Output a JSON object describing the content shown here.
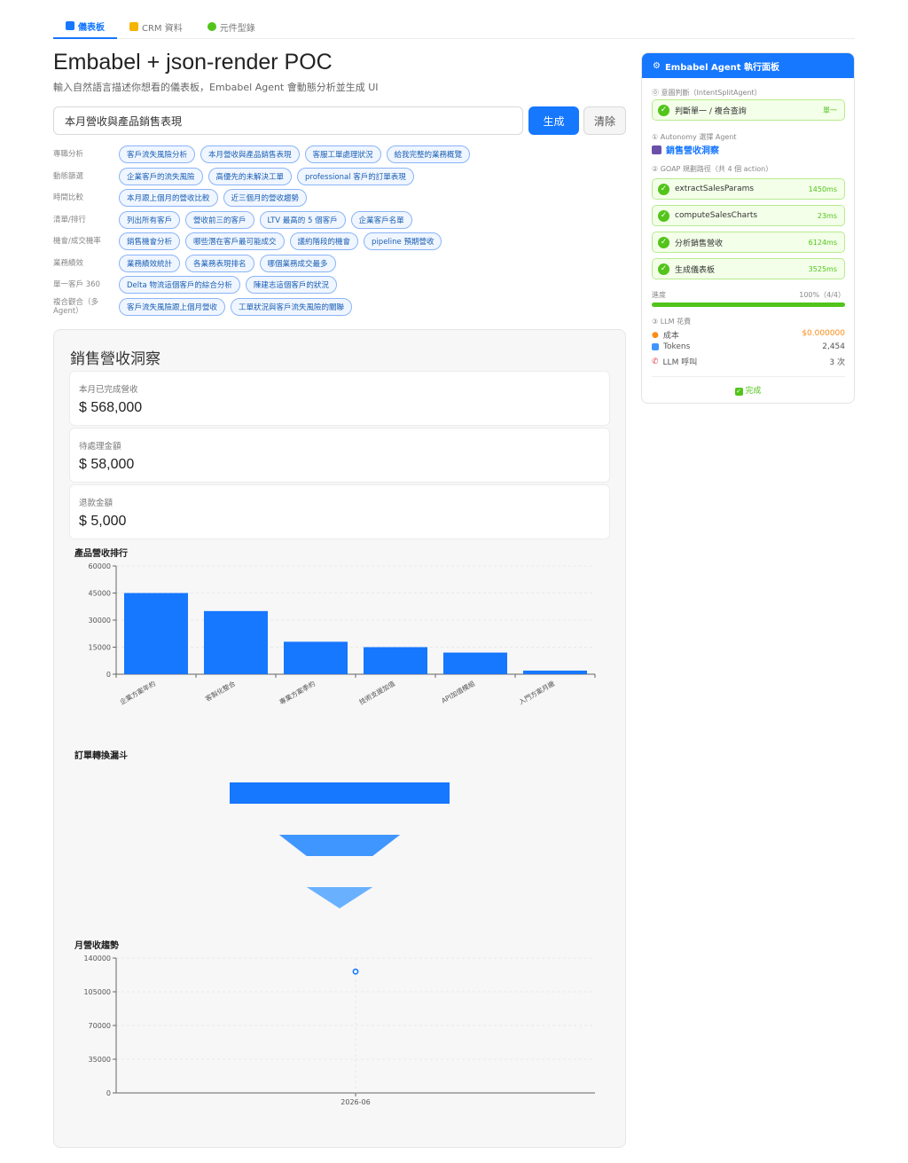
{
  "nav": {
    "tabs": [
      {
        "label": "儀表板",
        "icon": "bar-chart-icon",
        "color": "#1677ff"
      },
      {
        "label": "CRM 資料",
        "icon": "folder-icon",
        "color": "#f5b400"
      },
      {
        "label": "元件型錄",
        "icon": "puzzle-icon",
        "color": "#52c41a"
      }
    ]
  },
  "header": {
    "title": "Embabel + json-render POC",
    "subtitle": "輸入自然語言描述你想看的儀表板，Embabel Agent 會動態分析並生成 UI"
  },
  "query": {
    "value": "本月營收與產品銷售表現",
    "generate_label": "生成",
    "clear_label": "清除"
  },
  "suggestions": [
    {
      "category": "專職分析",
      "chips": [
        "客戶流失風險分析",
        "本月營收與產品銷售表現",
        "客服工單處理狀況",
        "給我完整的業務概覽"
      ]
    },
    {
      "category": "動態篩選",
      "chips": [
        "企業客戶的流失風險",
        "高優先的未解決工單",
        "professional 客戶的訂單表現"
      ]
    },
    {
      "category": "時間比較",
      "chips": [
        "本月跟上個月的營收比較",
        "近三個月的營收趨勢"
      ]
    },
    {
      "category": "清單/排行",
      "chips": [
        "列出所有客戶",
        "營收前三的客戶",
        "LTV 最高的 5 個客戶",
        "企業客戶名單"
      ]
    },
    {
      "category": "機會/成交機率",
      "chips": [
        "銷售機會分析",
        "哪些潛在客戶最可能成交",
        "議約階段的機會",
        "pipeline 預期營收"
      ]
    },
    {
      "category": "業務績效",
      "chips": [
        "業務績效統計",
        "各業務表現排名",
        "哪個業務成交最多"
      ]
    },
    {
      "category": "單一客戶 360",
      "chips": [
        "Delta 物流這個客戶的綜合分析",
        "陳建志這個客戶的狀況"
      ]
    },
    {
      "category": "複合觀合（多 Agent）",
      "chips": [
        "客戶流失風險跟上個月營收",
        "工單狀況與客戶流失風險的關聯"
      ]
    }
  ],
  "insight": {
    "title": "銷售營收洞察",
    "metrics": [
      {
        "label": "本月已完成營收",
        "value": "$ 568,000"
      },
      {
        "label": "待處理金額",
        "value": "$ 58,000"
      },
      {
        "label": "退款金額",
        "value": "$ 5,000"
      }
    ],
    "bar_title": "產品營收排行",
    "funnel_title": "訂單轉換漏斗",
    "line_title": "月營收趨勢"
  },
  "chart_data": [
    {
      "type": "bar",
      "title": "產品營收排行",
      "categories": [
        "企業方案年約",
        "客製化整合",
        "專業方案季約",
        "技術支援加值",
        "API加值模組",
        "入門方案月繳"
      ],
      "values": [
        45000,
        35000,
        18000,
        15000,
        12000,
        2000
      ],
      "ylim": [
        0,
        60000
      ],
      "yticks": [
        0,
        15000,
        30000,
        45000,
        60000
      ],
      "grid": true,
      "color": "#1677ff"
    },
    {
      "type": "funnel",
      "title": "訂單轉換漏斗",
      "values": [
        1.0,
        0.55,
        0.3
      ],
      "colors": [
        "#1677ff",
        "#4096ff",
        "#69b1ff"
      ]
    },
    {
      "type": "scatter",
      "title": "月營收趨勢",
      "x": [
        "2026-06"
      ],
      "values": [
        126000
      ],
      "ylim": [
        0,
        140000
      ],
      "yticks": [
        0,
        35000,
        70000,
        105000,
        140000
      ],
      "grid": true,
      "color": "#1677ff"
    }
  ],
  "panel": {
    "title": "Embabel Agent 執行面板",
    "intent_label": "⓪ 意圖判斷（IntentSplitAgent）",
    "intent_step": {
      "name": "判斷單一 / 複合查詢",
      "result": "單一"
    },
    "autonomy_label": "① Autonomy 選擇 Agent",
    "agent_name": "銷售營收洞察",
    "goap_label": "② GOAP 規劃路徑（共 4 個 action）",
    "steps": [
      {
        "name": "extractSalesParams",
        "time": "1450ms"
      },
      {
        "name": "computeSalesCharts",
        "time": "23ms"
      },
      {
        "name": "分析銷售營收",
        "time": "6124ms"
      },
      {
        "name": "生成儀表板",
        "time": "3525ms"
      }
    ],
    "progress_label": "進度",
    "progress_text": "100%（4/4）",
    "progress": 1.0,
    "llm_label": "③ LLM 花費",
    "costs": [
      {
        "key": "成本",
        "value": "$0.000000",
        "icon": "fire-icon",
        "color": "#fa8c16"
      },
      {
        "key": "Tokens",
        "value": "2,454",
        "icon": "tokens-icon",
        "color": "#333333"
      },
      {
        "key": "LLM 呼叫",
        "value": "3 次",
        "icon": "phone-icon",
        "color": "#333333"
      }
    ],
    "done_label": "完成"
  }
}
